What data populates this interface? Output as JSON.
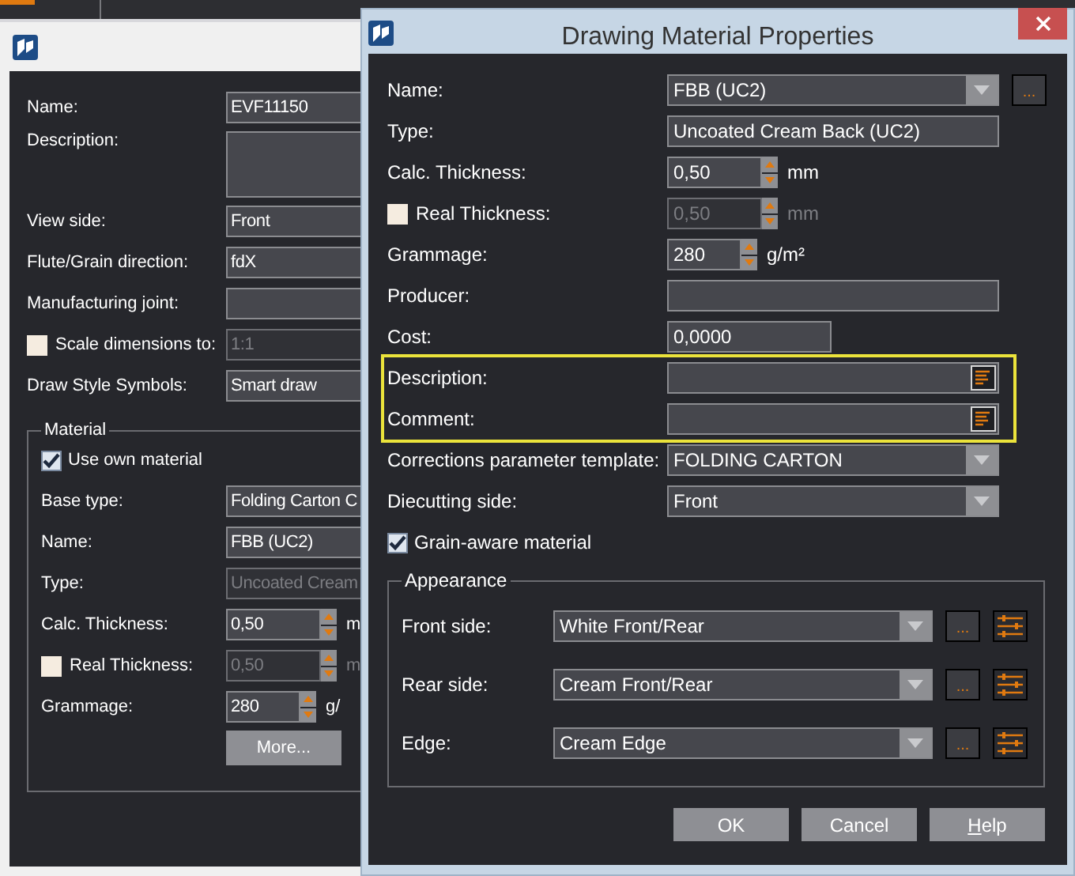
{
  "background_window": {
    "fields": [
      {
        "kind": "text",
        "label": "Name:",
        "value": "EVF11150",
        "disabled": false
      },
      {
        "kind": "textarea",
        "label": "Description:",
        "disabled": false
      },
      {
        "kind": "combo",
        "label": "View side:",
        "value": "Front",
        "disabled": false
      },
      {
        "kind": "combo",
        "label": "Flute/Grain direction:",
        "value": "fdX",
        "disabled": false
      },
      {
        "kind": "combo",
        "label": "Manufacturing joint:",
        "disabled": false
      },
      {
        "kind": "check-text",
        "label": "Scale dimensions to:",
        "checked": false,
        "value": "1:1",
        "disabled": true
      },
      {
        "kind": "combo",
        "label": "Draw Style Symbols:",
        "value": "Smart draw",
        "disabled": false
      }
    ],
    "material": {
      "title": "Material",
      "fields": [
        {
          "kind": "checkbox",
          "label": "Use own material",
          "checked": true
        },
        {
          "kind": "combo",
          "label": "Base type:",
          "value": "Folding Carton C",
          "disabled": false
        },
        {
          "kind": "combo",
          "label": "Name:",
          "value": "FBB (UC2)",
          "disabled": false
        },
        {
          "kind": "text",
          "label": "Type:",
          "value": "Uncoated Cream",
          "disabled": true
        },
        {
          "kind": "spin",
          "label": "Calc. Thickness:",
          "value": "0,50",
          "unit": "m",
          "disabled": false
        },
        {
          "kind": "check-spin",
          "label": "Real Thickness:",
          "checked": false,
          "value": "0,50",
          "unit": "m",
          "disabled": true
        },
        {
          "kind": "spin",
          "label": "Grammage:",
          "value": "280",
          "unit": "g/",
          "disabled": false
        }
      ],
      "button": "More..."
    }
  },
  "dialog": {
    "title": "Drawing Material Properties",
    "fields": [
      {
        "kind": "combo",
        "label": "Name:",
        "value": "FBB (UC2)",
        "browse": "...",
        "disabled": false
      },
      {
        "kind": "text",
        "label": "Type:",
        "value": "Uncoated Cream Back (UC2)",
        "disabled": false
      },
      {
        "kind": "spin",
        "label": "Calc. Thickness:",
        "value": "0,50",
        "unit": "mm",
        "disabled": false
      },
      {
        "kind": "check-spin",
        "label": "Real Thickness:",
        "checked": false,
        "value": "0,50",
        "unit": "mm",
        "disabled": true
      },
      {
        "kind": "spin",
        "label": "Grammage:",
        "value": "280",
        "unit": "g/m²",
        "disabled": false
      },
      {
        "kind": "text",
        "label": "Producer:",
        "disabled": false
      },
      {
        "kind": "number",
        "label": "Cost:",
        "value": "0,0000",
        "disabled": false
      },
      {
        "kind": "group",
        "highlighted": true,
        "fields": [
          {
            "kind": "note",
            "label": "Description:",
            "disabled": false
          },
          {
            "kind": "note",
            "label": "Comment:",
            "disabled": false
          }
        ]
      },
      {
        "kind": "combo",
        "label": "Corrections parameter template:",
        "value": "FOLDING CARTON",
        "disabled": false
      },
      {
        "kind": "combo",
        "label": "Diecutting side:",
        "value": "Front",
        "disabled": false
      },
      {
        "kind": "checkbox",
        "label": "Grain-aware material",
        "checked": true
      }
    ],
    "appearance": {
      "title": "Appearance",
      "rows": [
        {
          "label": "Front side:",
          "value": "White Front/Rear",
          "browse": "..."
        },
        {
          "label": "Rear side:",
          "value": "Cream Front/Rear",
          "browse": "..."
        },
        {
          "label": "Edge:",
          "value": "Cream Edge",
          "browse": "..."
        }
      ]
    },
    "buttons": [
      {
        "label": "OK"
      },
      {
        "label": "Cancel"
      },
      {
        "label": "Help",
        "access_key": true
      }
    ]
  }
}
